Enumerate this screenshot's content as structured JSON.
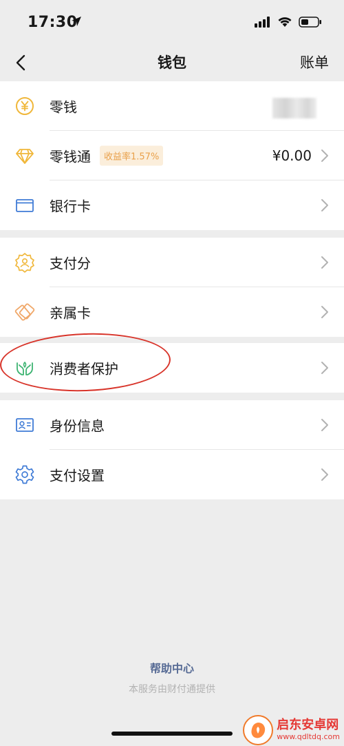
{
  "status": {
    "time": "17:30"
  },
  "nav": {
    "title": "钱包",
    "right": "账单"
  },
  "groups": {
    "money": {
      "lingqian": {
        "label": "零钱"
      },
      "lingqiantong": {
        "label": "零钱通",
        "badge": "收益率1.57%",
        "value": "¥0.00"
      },
      "bankcard": {
        "label": "银行卡"
      }
    },
    "services": {
      "payscore": {
        "label": "支付分"
      },
      "family": {
        "label": "亲属卡"
      }
    },
    "protect": {
      "consumer": {
        "label": "消费者保护"
      }
    },
    "settings": {
      "identity": {
        "label": "身份信息"
      },
      "paysettings": {
        "label": "支付设置"
      }
    }
  },
  "footer": {
    "help": "帮助中心",
    "provider": "本服务由财付通提供"
  },
  "watermark": {
    "name": "启东安卓网",
    "url": "www.qdltdq.com"
  },
  "colors": {
    "accent_gold": "#f0b73a",
    "bank_blue": "#3f7bd6",
    "green": "#3cb371",
    "link": "#576b95",
    "annotation_red": "#d8342a"
  }
}
